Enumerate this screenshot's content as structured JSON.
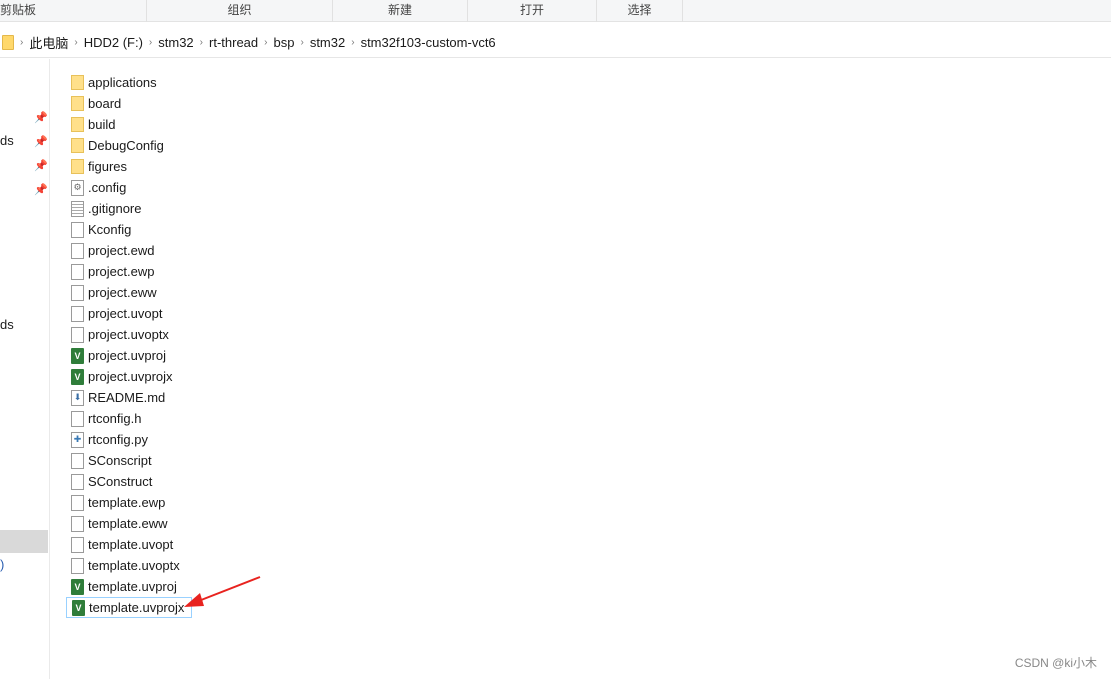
{
  "ribbon": {
    "groups": [
      "剪贴板",
      "组织",
      "新建",
      "打开",
      "选择"
    ]
  },
  "breadcrumb": [
    "此电脑",
    "HDD2 (F:)",
    "stm32",
    "rt-thread",
    "bsp",
    "stm32",
    "stm32f103-custom-vct6"
  ],
  "sidebar": {
    "fragments": [
      "ds",
      "ds",
      ")"
    ]
  },
  "files": [
    {
      "name": "applications",
      "icon": "folder"
    },
    {
      "name": "board",
      "icon": "folder"
    },
    {
      "name": "build",
      "icon": "folder"
    },
    {
      "name": "DebugConfig",
      "icon": "folder"
    },
    {
      "name": "figures",
      "icon": "folder"
    },
    {
      "name": ".config",
      "icon": "cfg"
    },
    {
      "name": ".gitignore",
      "icon": "txt"
    },
    {
      "name": "Kconfig",
      "icon": "file"
    },
    {
      "name": "project.ewd",
      "icon": "file"
    },
    {
      "name": "project.ewp",
      "icon": "file"
    },
    {
      "name": "project.eww",
      "icon": "file"
    },
    {
      "name": "project.uvopt",
      "icon": "file"
    },
    {
      "name": "project.uvoptx",
      "icon": "file"
    },
    {
      "name": "project.uvproj",
      "icon": "uv"
    },
    {
      "name": "project.uvprojx",
      "icon": "uv"
    },
    {
      "name": "README.md",
      "icon": "md"
    },
    {
      "name": "rtconfig.h",
      "icon": "file"
    },
    {
      "name": "rtconfig.py",
      "icon": "py"
    },
    {
      "name": "SConscript",
      "icon": "file"
    },
    {
      "name": "SConstruct",
      "icon": "file"
    },
    {
      "name": "template.ewp",
      "icon": "file"
    },
    {
      "name": "template.eww",
      "icon": "file"
    },
    {
      "name": "template.uvopt",
      "icon": "file"
    },
    {
      "name": "template.uvoptx",
      "icon": "file"
    },
    {
      "name": "template.uvproj",
      "icon": "uv"
    },
    {
      "name": "template.uvprojx",
      "icon": "uv",
      "selected": true
    }
  ],
  "watermark": "CSDN @ki小木",
  "colors": {
    "annotation_arrow": "#e8231f",
    "selection_border": "#99d1ff"
  }
}
